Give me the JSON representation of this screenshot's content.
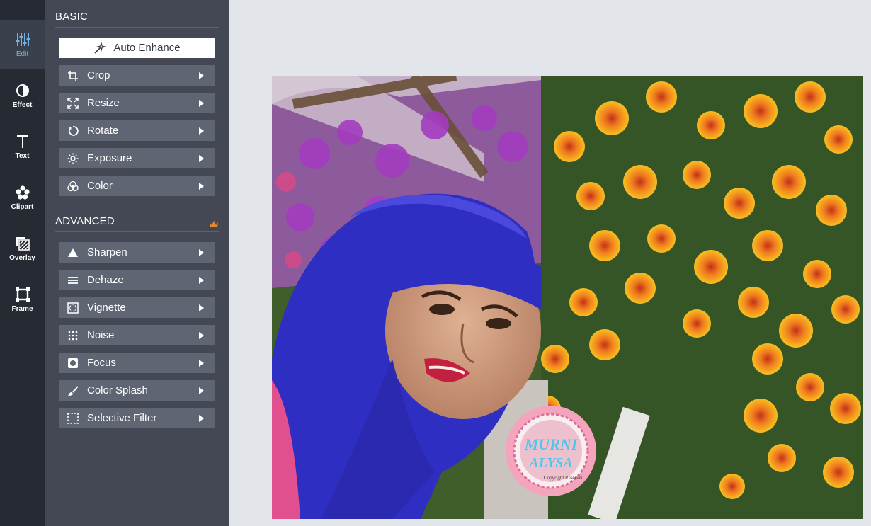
{
  "rail": [
    {
      "label": "Edit",
      "icon": "sliders-icon",
      "active": true
    },
    {
      "label": "Effect",
      "icon": "half-circle-icon"
    },
    {
      "label": "Text",
      "icon": "text-t-icon"
    },
    {
      "label": "Clipart",
      "icon": "flower-icon"
    },
    {
      "label": "Overlay",
      "icon": "overlay-icon"
    },
    {
      "label": "Frame",
      "icon": "frame-icon"
    }
  ],
  "panel": {
    "basic_heading": "BASIC",
    "auto_enhance": "Auto Enhance",
    "basic_tools": [
      "Crop",
      "Resize",
      "Rotate",
      "Exposure",
      "Color"
    ],
    "advanced_heading": "ADVANCED",
    "advanced_tools": [
      "Sharpen",
      "Dehaze",
      "Vignette",
      "Noise",
      "Focus",
      "Color Splash",
      "Selective Filter"
    ]
  },
  "photo": {
    "watermark_line1": "MURNI",
    "watermark_line2": "ALYSA",
    "watermark_small": "Copyright Reserved"
  },
  "colors": {
    "rail_bg": "#252a33",
    "panel_bg": "#434854",
    "tool_bg": "#5f6572",
    "active_accent": "#6fb1e4",
    "crown": "#e08a2a",
    "workspace_bg": "#e2e5e9"
  }
}
